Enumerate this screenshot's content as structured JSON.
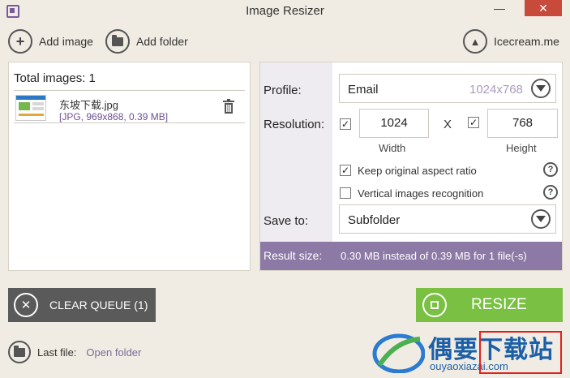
{
  "window": {
    "title": "Image Resizer",
    "minimize": "—",
    "close": "✕"
  },
  "toolbar": {
    "add_image": "Add image",
    "add_folder": "Add folder",
    "brand": "Icecream.me"
  },
  "queue": {
    "total_label": "Total images: 1",
    "files": [
      {
        "name": "东坡下载.jpg",
        "info": "[JPG, 969x868, 0.39 MB]"
      }
    ]
  },
  "settings": {
    "profile_label": "Profile:",
    "profile_value": "Email",
    "profile_size": "1024x768",
    "resolution_label": "Resolution:",
    "width_value": "1024",
    "height_value": "768",
    "x_separator": "X",
    "width_caption": "Width",
    "height_caption": "Height",
    "keep_aspect": "Keep original aspect ratio",
    "keep_aspect_checked": true,
    "vertical_recognition": "Vertical images recognition",
    "vertical_recognition_checked": false,
    "save_to_label": "Save to:",
    "save_to_value": "Subfolder",
    "result_label": "Result size:",
    "result_text": "0.30 MB instead of 0.39 MB for 1 file(-s)"
  },
  "actions": {
    "clear_queue": "CLEAR QUEUE (1)",
    "resize": "RESIZE"
  },
  "footer": {
    "last_file_label": "Last file:",
    "open_folder": "Open folder"
  },
  "watermark": {
    "main": "偶要下载站",
    "sub": "ouyaoxiazai.com"
  },
  "colors": {
    "accent_purple": "#8c79a6",
    "resize_green": "#7ac043",
    "clear_dark": "#5a5a5a",
    "close_red": "#c74a3a"
  }
}
